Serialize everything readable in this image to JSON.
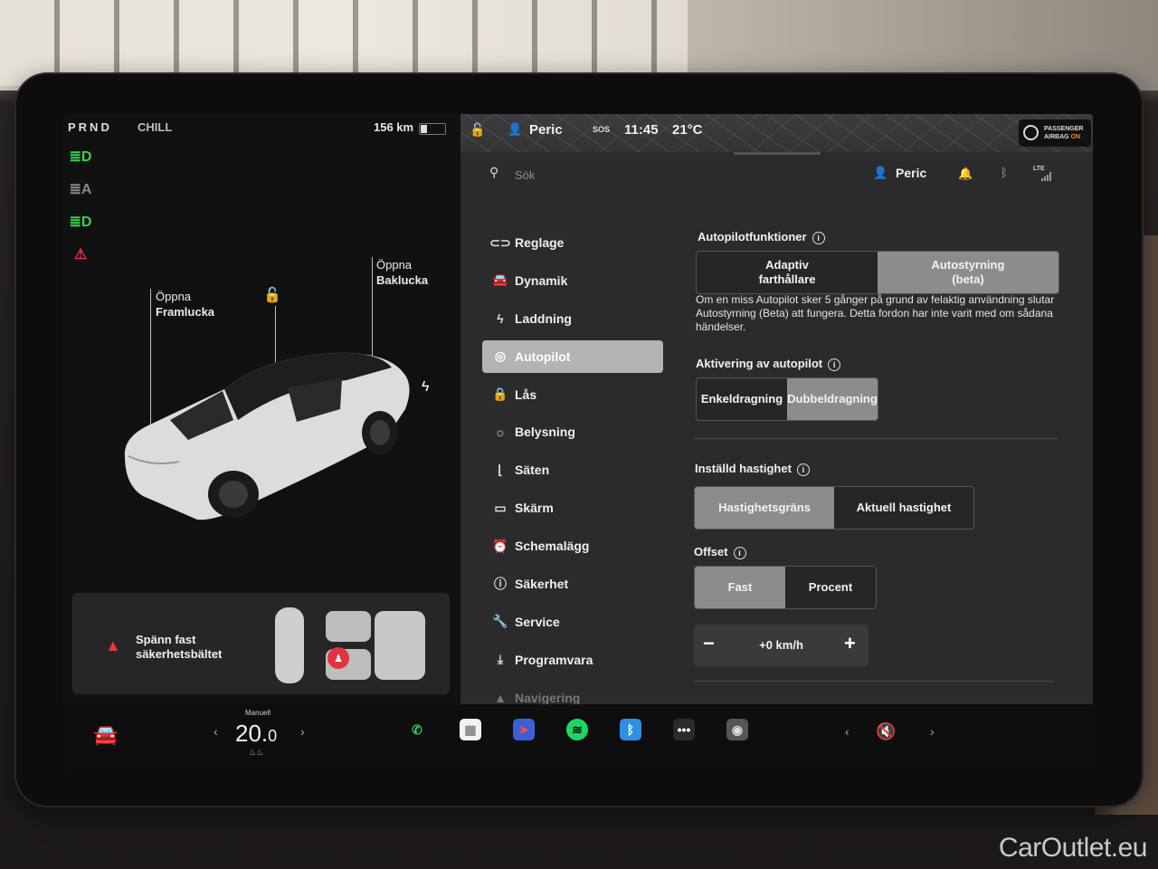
{
  "car_status": {
    "gear": "PRND",
    "drive_mode": "CHILL",
    "range": "156 km",
    "battery_level_fraction": 0.25,
    "indicators": [
      {
        "name": "headlight-icon",
        "glyph": "≣D",
        "color": "#39d34a"
      },
      {
        "name": "auto-highbeam-icon",
        "glyph": "≣A",
        "color": "#8a8a8a"
      },
      {
        "name": "fog-light-icon",
        "glyph": "≣D",
        "color": "#39d34a"
      },
      {
        "name": "seatbelt-warning-icon",
        "glyph": "⚠",
        "color": "#e0353f"
      }
    ],
    "frunk_label_line1": "Öppna",
    "frunk_label_line2": "Framlucka",
    "trunk_label_line1": "Öppna",
    "trunk_label_line2": "Baklucka",
    "alert_text": "Spänn fast säkerhetsbältet"
  },
  "topbar": {
    "profile": "Peric",
    "sos": "SOS",
    "time": "11:45",
    "temperature": "21°C",
    "airbag_line1": "PASSENGER",
    "airbag_line2": "AIRBAG",
    "airbag_state": "ON"
  },
  "search": {
    "placeholder": "Sök"
  },
  "header": {
    "user": "Peric",
    "lte": "LTE"
  },
  "menu": {
    "items": [
      {
        "label": "Reglage",
        "icon": "toggle-icon",
        "glyph": "⊂⊃"
      },
      {
        "label": "Dynamik",
        "icon": "car-icon",
        "glyph": "🚘"
      },
      {
        "label": "Laddning",
        "icon": "bolt-icon",
        "glyph": "ϟ"
      },
      {
        "label": "Autopilot",
        "icon": "steering-wheel-icon",
        "glyph": "◎"
      },
      {
        "label": "Lås",
        "icon": "lock-icon",
        "glyph": "🔒"
      },
      {
        "label": "Belysning",
        "icon": "sun-icon",
        "glyph": "☼"
      },
      {
        "label": "Säten",
        "icon": "seat-icon",
        "glyph": "⌊"
      },
      {
        "label": "Skärm",
        "icon": "display-icon",
        "glyph": "▭"
      },
      {
        "label": "Schemalägg",
        "icon": "alarm-clock-icon",
        "glyph": "⏰"
      },
      {
        "label": "Säkerhet",
        "icon": "safety-icon",
        "glyph": "ⓘ"
      },
      {
        "label": "Service",
        "icon": "wrench-icon",
        "glyph": "🔧"
      },
      {
        "label": "Programvara",
        "icon": "download-icon",
        "glyph": "⤓"
      },
      {
        "label": "Navigering",
        "icon": "navigation-icon",
        "glyph": "▲"
      }
    ],
    "active_index": 3
  },
  "autopilot": {
    "features_title": "Autopilotfunktioner",
    "features_options": [
      "Adaptiv\nfarthållare",
      "Autostyrning\n(beta)"
    ],
    "features_selected": 1,
    "description": "Om en miss Autopilot sker 5 gånger på grund av felaktig användning slutar Autostyrning (Beta) att fungera. Detta fordon har inte varit med om sådana händelser.",
    "activation_title": "Aktivering av autopilot",
    "activation_options": [
      "Enkeldragning",
      "Dubbeldragning"
    ],
    "activation_selected": 1,
    "speed_title": "Inställd hastighet",
    "speed_options": [
      "Hastighetsgräns",
      "Aktuell hastighet"
    ],
    "speed_selected": 0,
    "offset_title": "Offset",
    "offset_options": [
      "Fast",
      "Procent"
    ],
    "offset_selected": 0,
    "offset_value": "+0 km/h",
    "minus": "−",
    "plus": "+"
  },
  "dock": {
    "climate_mode": "Manuell",
    "temp_int": "20.",
    "temp_dec": "0",
    "apps": [
      {
        "name": "phone-icon",
        "glyph": "✆",
        "bg": "#0e0e0f",
        "fg": "#2ecc55"
      },
      {
        "name": "calendar-icon",
        "glyph": "▦",
        "bg": "#f2f2f2",
        "fg": "#888"
      },
      {
        "name": "navigation-app-icon",
        "glyph": "➤",
        "bg": "#3a5fd8",
        "fg": "#f05040"
      },
      {
        "name": "spotify-icon",
        "glyph": "≋",
        "bg": "#1ed760",
        "fg": "#0e0e0f"
      },
      {
        "name": "bluetooth-app-icon",
        "glyph": "ᛒ",
        "bg": "#2f8fe0",
        "fg": "#fff"
      },
      {
        "name": "more-apps-icon",
        "glyph": "•••",
        "bg": "#2a2a2c",
        "fg": "#fff"
      },
      {
        "name": "dashcam-icon",
        "glyph": "◉",
        "bg": "#555",
        "fg": "#ddd"
      }
    ]
  },
  "watermark": "CarOutlet.eu"
}
